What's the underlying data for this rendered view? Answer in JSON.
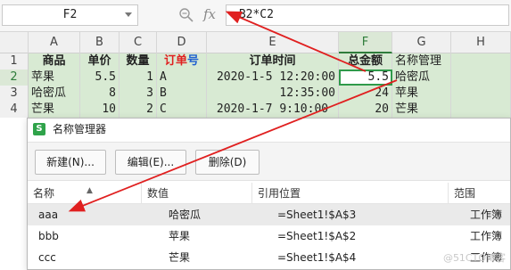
{
  "formula_bar": {
    "name_box": "F2",
    "fx_label": "fx",
    "formula": "=B2*C2"
  },
  "sheet": {
    "columns": [
      "A",
      "B",
      "C",
      "D",
      "E",
      "F",
      "G",
      "H"
    ],
    "row_numbers": [
      "1",
      "2",
      "3",
      "4"
    ],
    "headers": {
      "a": "商品",
      "b": "单价",
      "c": "数量",
      "d_red": "订单",
      "d_blue": "号",
      "e": "订单时间",
      "f": "总金额",
      "g": "名称管理"
    },
    "rows": [
      {
        "a": "苹果",
        "b": "5.5",
        "c": "1",
        "d": "A",
        "e": "2020-1-5 12:20:00",
        "f": "5.5",
        "g": "哈密瓜"
      },
      {
        "a": "哈密瓜",
        "b": "8",
        "c": "3",
        "d": "B",
        "e": "12:35:00",
        "f": "24",
        "g": "苹果"
      },
      {
        "a": "芒果",
        "b": "10",
        "c": "2",
        "d": "C",
        "e": "2020-1-7 9:10:00",
        "f": "20",
        "g": "芒果"
      }
    ]
  },
  "dialog": {
    "icon_letter": "S",
    "title": "名称管理器",
    "buttons": {
      "new": "新建(N)...",
      "edit": "编辑(E)...",
      "delete": "删除(D)"
    },
    "columns": {
      "name": "名称",
      "value": "数值",
      "refers_to": "引用位置",
      "scope": "范围"
    },
    "rows": [
      {
        "name": "aaa",
        "value": "哈密瓜",
        "refers_to": "=Sheet1!$A$3",
        "scope": "工作簿"
      },
      {
        "name": "bbb",
        "value": "苹果",
        "refers_to": "=Sheet1!$A$2",
        "scope": "工作簿"
      },
      {
        "name": "ccc",
        "value": "芒果",
        "refers_to": "=Sheet1!$A$4",
        "scope": "工作簿"
      }
    ]
  },
  "watermark": "@51CTO博客",
  "colors": {
    "selected_green": "#2f9a4a",
    "cell_fill": "#d8ead3",
    "annotation_red": "#e02020"
  }
}
